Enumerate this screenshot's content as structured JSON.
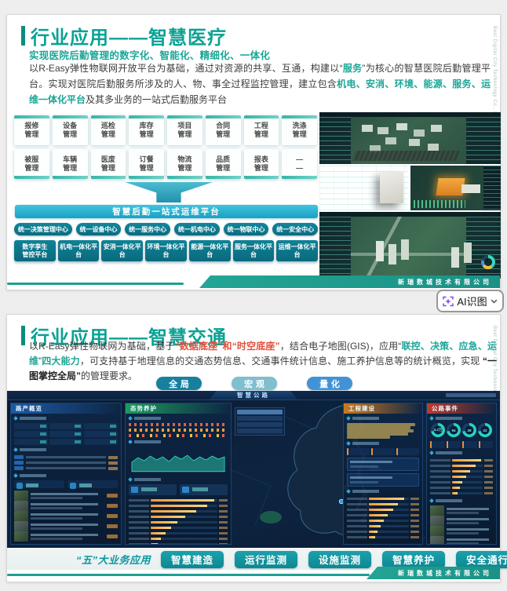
{
  "chrome": {
    "ai_button": {
      "label": "AI识图"
    },
    "icons": {
      "ai_button_icon": "sparkle-scan",
      "ai_button_chevron": "chevron-down"
    },
    "side_text": "Best Digital City Technology Co., Ltd",
    "company_footer": "新瑞数城技术有限公司"
  },
  "slide1": {
    "title": "行业应用——智慧医疗",
    "subtitle": "实现医院后勤管理的数字化、智能化、精细化、一体化",
    "paragraph": [
      {
        "t": "以R-Easy弹性物联网开放平台为基础，通过对资源的共享、互通，构建以“",
        "c": "n"
      },
      {
        "t": "服务",
        "c": "t"
      },
      {
        "t": "”为核心的智慧医院后勤管理平台。实现对医院后勤服务所涉及的人、物、事全过程监控管理，建立包含",
        "c": "n"
      },
      {
        "t": "机电、安消、环境、能源、服务、运维一体化平台",
        "c": "t"
      },
      {
        "t": "及其多业务的一站式后勤服务平台",
        "c": "n"
      }
    ],
    "modules_row1": [
      "报修\n管理",
      "设备\n管理",
      "巡检\n管理",
      "库存\n管理",
      "项目\n管理",
      "合同\n管理",
      "工程\n管理",
      "洗涤\n管理"
    ],
    "modules_row2": [
      "被服\n管理",
      "车辆\n管理",
      "医废\n管理",
      "订餐\n管理",
      "物流\n管理",
      "品质\n管理",
      "报表\n管理",
      "—\n—"
    ],
    "banner": "智慧后勤一站式运维平台",
    "centers": [
      "统一决策管理中心",
      "统一设备中心",
      "统一服务中心",
      "统一机电中心",
      "统一物联中心",
      "统一安全中心"
    ],
    "platforms": [
      "数字孪生\n管控平台",
      "机电一体化平台",
      "安消一体化平台",
      "环境一体化平台",
      "能源一体化平台",
      "服务一体化平台",
      "运维一体化平台"
    ]
  },
  "slide2": {
    "title": "行业应用——智慧交通",
    "paragraph": [
      {
        "t": "以R-Easy弹性物联网为基础，基于",
        "c": "n"
      },
      {
        "t": "“数据底座”和“时空底座”",
        "c": "r"
      },
      {
        "t": "，结合电子地图(GIS)，应用“",
        "c": "n"
      },
      {
        "t": "联控、决策、应急、运维",
        "c": "t"
      },
      {
        "t": "”",
        "c": "n"
      },
      {
        "t": "四大能力",
        "c": "t"
      },
      {
        "t": "，可支持基于地理信息的交通态势信息、交通事件统计信息、施工养护信息等的统计概览，实现 ",
        "c": "n"
      },
      {
        "t": "“一图掌控全局”",
        "c": "b"
      },
      {
        "t": "的管理要求。",
        "c": "n"
      }
    ],
    "view_buttons": [
      {
        "label": "全局",
        "color": "#17809f"
      },
      {
        "label": "宏观",
        "color": "#7fbfce"
      },
      {
        "label": "量化",
        "color": "#4392d6"
      }
    ],
    "dashboard": {
      "title": "智慧公路",
      "panel_left": "路产概览",
      "panel_mid": "态势养护",
      "panel_eng": "工程建设",
      "panel_event": "公路事件",
      "rings": [
        "4.2万",
        "94",
        "28",
        "22"
      ]
    },
    "bottom_label": "“五”大业务应用",
    "apps": [
      "智慧建造",
      "运行监测",
      "设施监测",
      "智慧养护",
      "安全通行服务"
    ]
  },
  "decor": {
    "mid_bars": [
      95,
      85,
      68,
      52,
      40,
      30,
      22,
      15,
      10
    ],
    "eng_bars": [
      88,
      72,
      60,
      48,
      38,
      30,
      22,
      16
    ],
    "event_bars": [
      96,
      78,
      60,
      45,
      34,
      25,
      18
    ],
    "yellow_rows": [
      95,
      88,
      92,
      85,
      60
    ]
  }
}
